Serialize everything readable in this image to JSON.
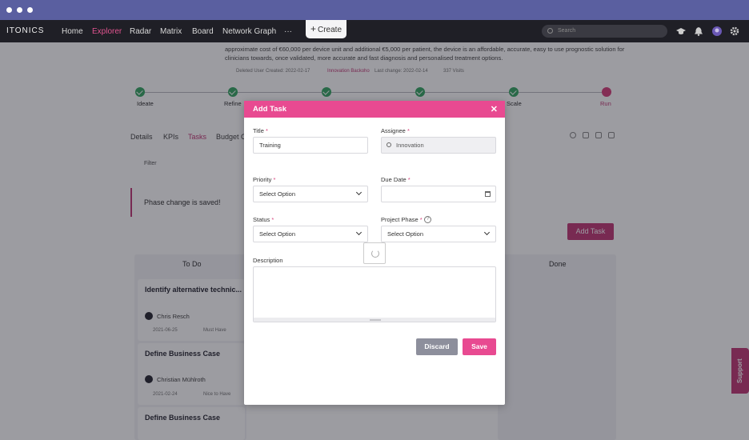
{
  "nav": {
    "logo": "ITONICS",
    "items": [
      "Home",
      "Explorer",
      "Radar",
      "Matrix",
      "Board",
      "Network Graph",
      "···"
    ],
    "active": "Explorer",
    "create_label": "Create",
    "search_placeholder": "Search"
  },
  "background": {
    "description": "approximate cost of €60,000 per device unit and additional €5,000 per patient, the device is an affordable, accurate, easy to use prognostic solution for clinicians towards, once validated, more accurate and fast diagnosis and personalised treatment options.",
    "meta": {
      "deleted_user": "Deleted User",
      "created": "Created: 2022-02-17",
      "editor": "Innovation Backoho",
      "last_change": "Last change: 2022-02-14",
      "visits": "337 Visits"
    },
    "phases": [
      "Ideate",
      "Refine",
      "",
      "",
      "Scale",
      "Run"
    ],
    "tabs": [
      "Details",
      "KPIs",
      "Tasks",
      "Budget C"
    ],
    "active_tab": "Tasks",
    "filter_label": "Filter",
    "toast": "Phase change is saved!",
    "add_task_label": "Add Task",
    "columns": {
      "todo": "To Do",
      "done": "Done"
    },
    "cards": [
      {
        "title": "Identify alternative technic...",
        "person": "Chris Resch",
        "date": "2021-06-25",
        "priority": "Must Have"
      },
      {
        "title": "Define Business Case",
        "person": "Christian Mühlroth",
        "date": "2021-02-24",
        "priority": "Nice to Have"
      },
      {
        "title": "Define Business Case",
        "person": "",
        "date": "",
        "priority": ""
      }
    ],
    "support_label": "Support"
  },
  "modal": {
    "title": "Add Task",
    "fields": {
      "title": {
        "label": "Title",
        "value": "Training"
      },
      "assignee": {
        "label": "Assignee",
        "value": "Innovation"
      },
      "priority": {
        "label": "Priority",
        "value": "Select Option"
      },
      "due_date": {
        "label": "Due Date",
        "value": ""
      },
      "status": {
        "label": "Status",
        "value": "Select Option"
      },
      "project_phase": {
        "label": "Project Phase",
        "value": "Select Option"
      },
      "description": {
        "label": "Description",
        "value": ""
      }
    },
    "required_mark": "*",
    "help_mark": "?",
    "discard_label": "Discard",
    "save_label": "Save"
  },
  "colors": {
    "accent": "#e84a91",
    "nav_bg": "#1f1f26",
    "success": "#3aa867",
    "discard": "#8d8f9c"
  }
}
